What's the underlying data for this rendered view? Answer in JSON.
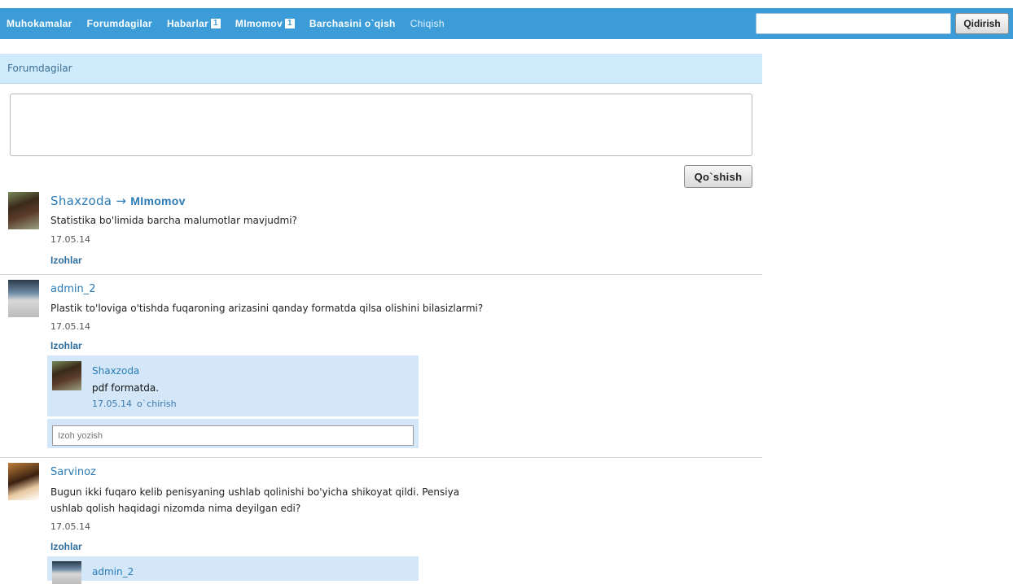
{
  "nav": {
    "items": [
      {
        "label": "Muhokamalar"
      },
      {
        "label": "Forumdagilar"
      },
      {
        "label": "Habarlar",
        "badge": "1"
      },
      {
        "label": "MImomov",
        "badge": "1"
      },
      {
        "label": "Barchasini o`qish"
      },
      {
        "label": "Chiqish"
      }
    ],
    "search_value": "",
    "search_button": "Qidirish"
  },
  "section": {
    "title": "Forumdagilar"
  },
  "composer": {
    "value": "",
    "submit_label": "Qo`shish"
  },
  "posts": [
    {
      "author": "Shaxzoda",
      "arrow": "→",
      "target": "MImomov",
      "text": "Statistika bo'limida barcha malumotlar mavjudmi?",
      "date": "17.05.14",
      "comments_label": "Izohlar"
    },
    {
      "author": "admin_2",
      "text": "Plastik to'loviga o'tishda fuqaroning arizasini qanday formatda qilsa olishini bilasizlarmi?",
      "date": "17.05.14",
      "comments_label": "Izohlar",
      "comment": {
        "author": "Shaxzoda",
        "text": "pdf formatda.",
        "date": "17.05.14",
        "delete_label": "o`chirish"
      },
      "comment_placeholder": "Izoh yozish"
    },
    {
      "author": "Sarvinoz",
      "text_line1": "Bugun ikki fuqaro kelib penisyaning ushlab qolinishi bo'yicha shikoyat qildi. Pensiya",
      "text_line2": "ushlab qolish haqidagi nizomda nima deyilgan edi?",
      "date": "17.05.14",
      "comments_label": "Izohlar",
      "comment": {
        "author": "admin_2"
      }
    }
  ],
  "icons": {
    "avatar_shaxzoda": "user-photo",
    "avatar_admin": "computer-monitor",
    "avatar_sarvinoz": "user-photo"
  }
}
